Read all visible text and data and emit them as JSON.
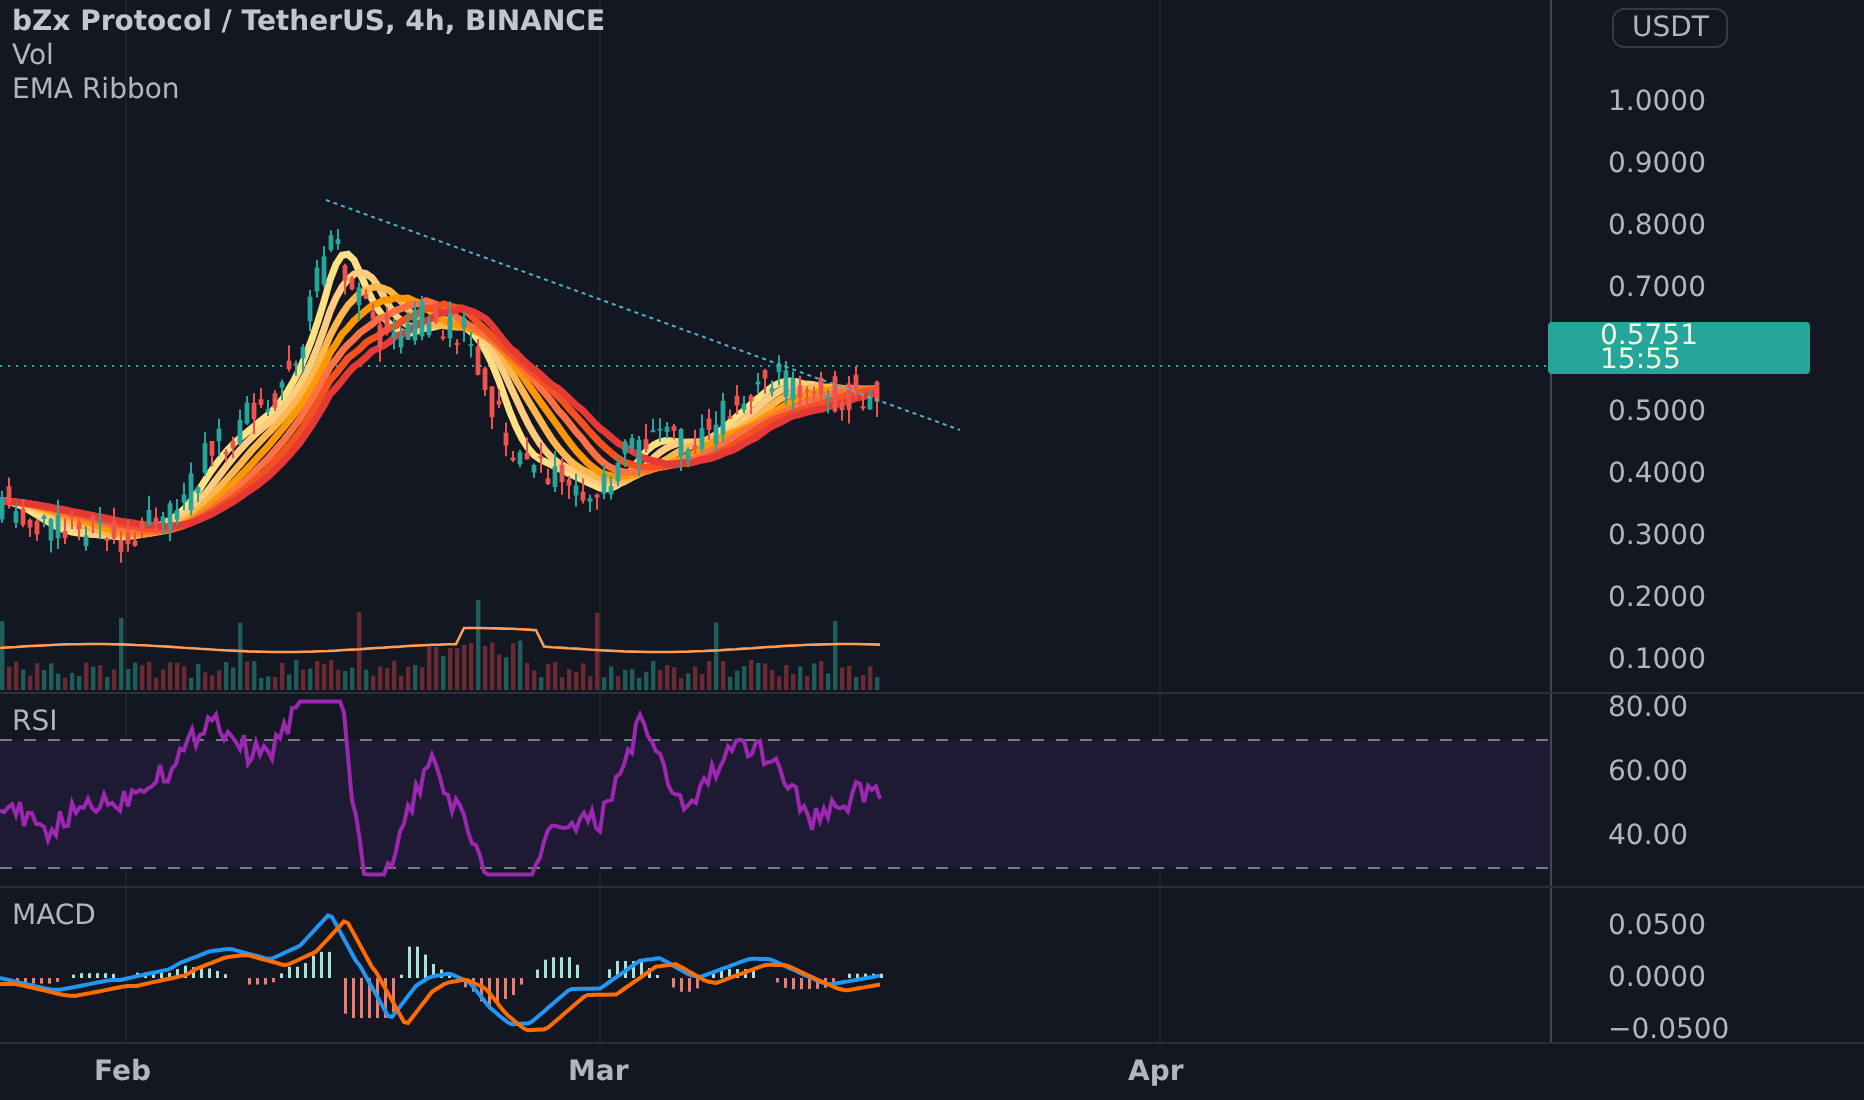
{
  "legend": {
    "title": "bZx Protocol / TetherUS, 4h, BINANCE",
    "indicators": [
      "Vol",
      "EMA Ribbon"
    ]
  },
  "currency": "USDT",
  "price_axis_upper": [
    "1.0000",
    "0.9000",
    "0.8000",
    "0.7000"
  ],
  "last_price": {
    "price": "0.5751",
    "countdown": "15:55"
  },
  "price_axis_lower": [
    "0.5000",
    "0.4000",
    "0.3000",
    "0.2000",
    "0.1000"
  ],
  "rsi": {
    "title": "RSI",
    "axis": [
      "80.00",
      "60.00",
      "40.00"
    ]
  },
  "macd": {
    "title": "MACD",
    "axis": [
      "0.0500",
      "0.0000",
      "−0.0500"
    ]
  },
  "time_axis": [
    "Feb",
    "Mar",
    "Apr"
  ]
}
